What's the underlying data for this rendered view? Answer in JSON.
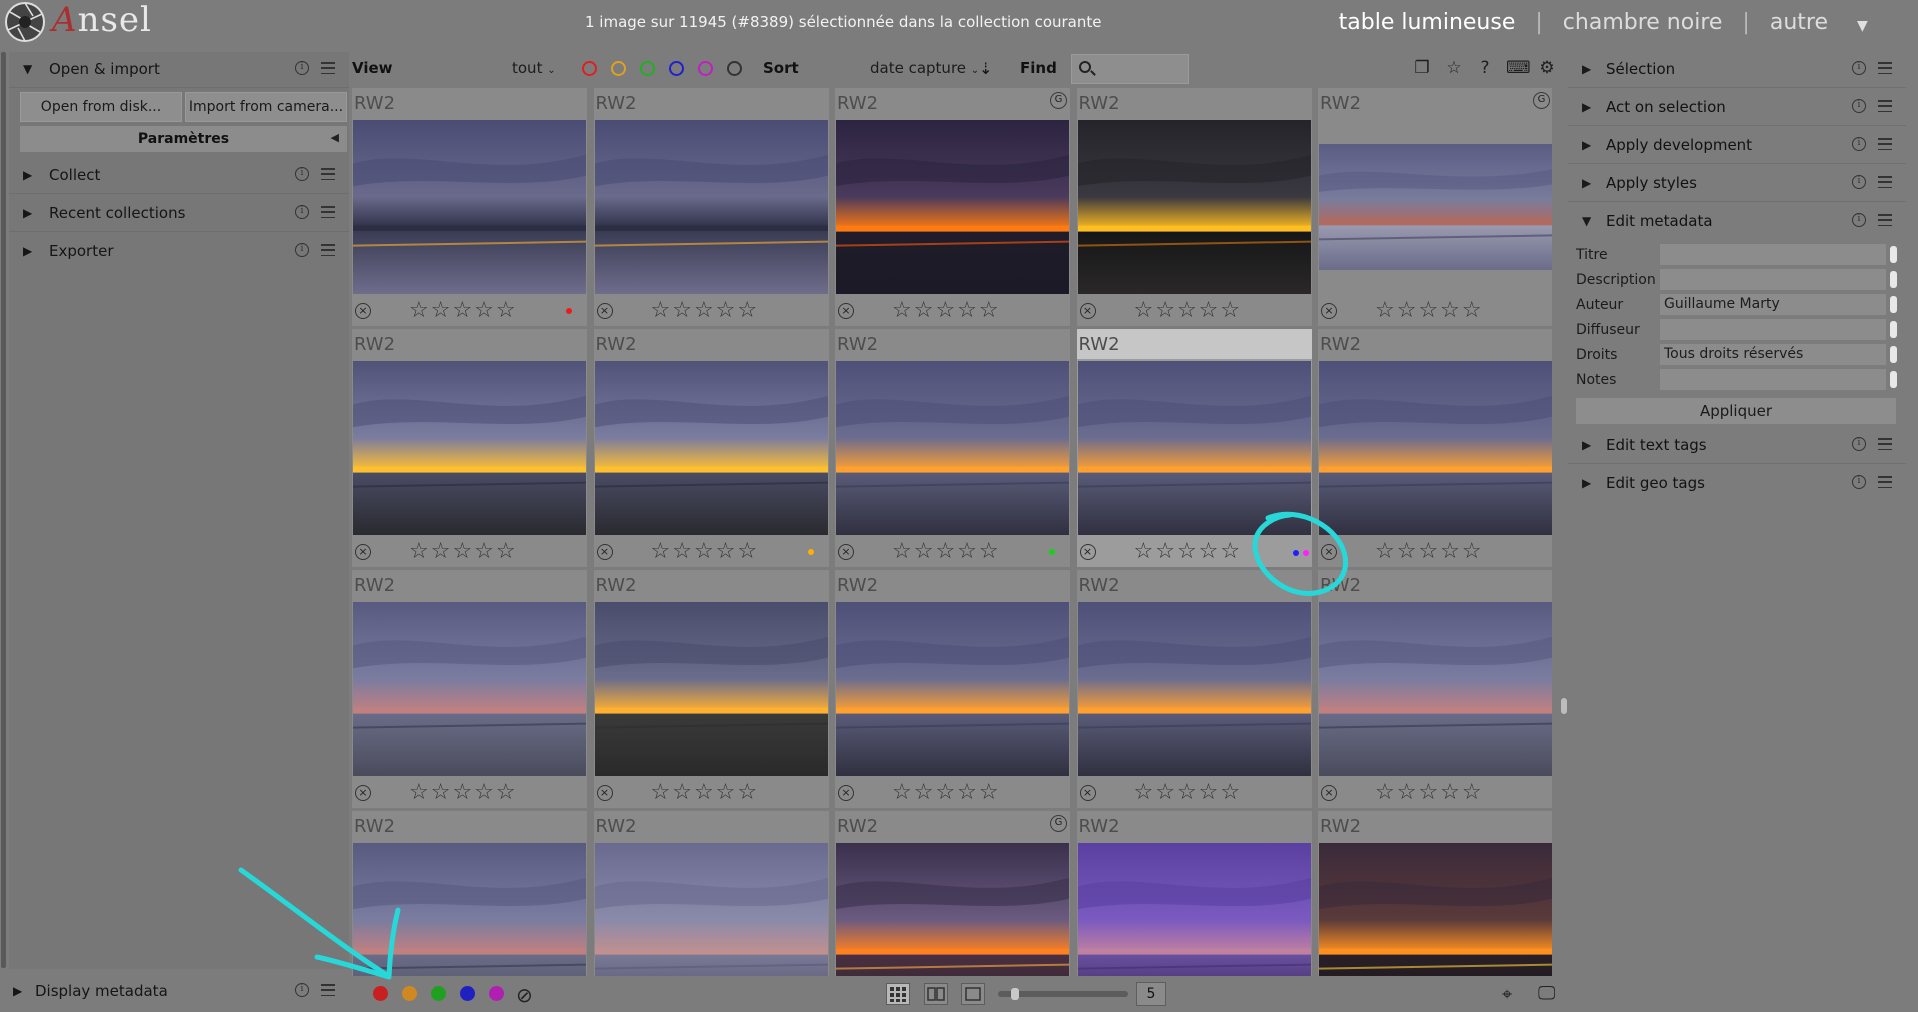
{
  "app": {
    "name": "Ansel",
    "status": "1 image sur 11945 (#8389) sélectionnée dans la collection courante",
    "views": [
      "table lumineuse",
      "chambre noire",
      "autre"
    ],
    "view_separator": "|",
    "active_view": "table lumineuse",
    "menu_arrow": "▼"
  },
  "left_panel": {
    "modules": [
      {
        "label": "Open & import",
        "expanded": true
      },
      {
        "label": "Collect",
        "expanded": false
      },
      {
        "label": "Recent collections",
        "expanded": false
      },
      {
        "label": "Exporter",
        "expanded": false
      }
    ],
    "buttons": {
      "open_disk": "Open from disk...",
      "import_camera": "Import from camera...",
      "params": "Paramètres"
    },
    "bottom_module": "Display metadata"
  },
  "toolbar": {
    "view_label": "View",
    "rating_filter": "tout",
    "color_filters": [
      "#dd2020",
      "#e0a020",
      "#20b020",
      "#2020d0",
      "#c020c0",
      "#8a8a8a"
    ],
    "sort_label": "Sort",
    "sort_value": "date capture",
    "find_label": "Find",
    "search_placeholder": ""
  },
  "grid": {
    "rows": 4,
    "cols": 5,
    "selected": [
      1,
      3
    ],
    "thumbs": [
      {
        "ext": "RW2",
        "grouped": false,
        "labels": [
          "#ee1a1a"
        ],
        "style": "a"
      },
      {
        "ext": "RW2",
        "grouped": false,
        "labels": [],
        "style": "a"
      },
      {
        "ext": "RW2",
        "grouped": true,
        "labels": [],
        "style": "b"
      },
      {
        "ext": "RW2",
        "grouped": false,
        "labels": [],
        "style": "c"
      },
      {
        "ext": "RW2",
        "grouped": true,
        "labels": [],
        "style": "d"
      },
      {
        "ext": "RW2",
        "grouped": false,
        "labels": [],
        "style": "e"
      },
      {
        "ext": "RW2",
        "grouped": false,
        "labels": [
          "#ffb000"
        ],
        "style": "e"
      },
      {
        "ext": "RW2",
        "grouped": false,
        "labels": [
          "#18d018"
        ],
        "style": "f"
      },
      {
        "ext": "RW2",
        "grouped": false,
        "labels": [
          "#2020ff",
          "#ff20ff"
        ],
        "style": "f"
      },
      {
        "ext": "RW2",
        "grouped": false,
        "labels": [],
        "style": "f"
      },
      {
        "ext": "RW2",
        "grouped": false,
        "labels": [],
        "style": "g"
      },
      {
        "ext": "RW2",
        "grouped": false,
        "labels": [],
        "style": "h"
      },
      {
        "ext": "RW2",
        "grouped": false,
        "labels": [],
        "style": "f"
      },
      {
        "ext": "RW2",
        "grouped": false,
        "labels": [],
        "style": "f"
      },
      {
        "ext": "RW2",
        "grouped": false,
        "labels": [],
        "style": "g"
      },
      {
        "ext": "RW2",
        "grouped": false,
        "labels": [],
        "style": "g"
      },
      {
        "ext": "RW2",
        "grouped": false,
        "labels": [],
        "style": "i"
      },
      {
        "ext": "RW2",
        "grouped": true,
        "labels": [],
        "style": "j"
      },
      {
        "ext": "RW2",
        "grouped": false,
        "labels": [],
        "style": "k"
      },
      {
        "ext": "RW2",
        "grouped": false,
        "labels": [],
        "style": "l"
      }
    ],
    "stars_text": "☆☆☆☆☆",
    "reject_symbol": "×",
    "group_symbol": "G"
  },
  "right_panel": {
    "modules_top": [
      "Sélection",
      "Act on selection",
      "Apply development",
      "Apply styles"
    ],
    "edit_metadata": {
      "label": "Edit metadata",
      "fields": [
        {
          "key": "Titre",
          "value": ""
        },
        {
          "key": "Description",
          "value": ""
        },
        {
          "key": "Auteur",
          "value": "Guillaume Marty"
        },
        {
          "key": "Diffuseur",
          "value": ""
        },
        {
          "key": "Droits",
          "value": "Tous droits réservés"
        },
        {
          "key": "Notes",
          "value": ""
        }
      ],
      "apply": "Appliquer"
    },
    "modules_bottom": [
      "Edit text tags",
      "Edit geo tags"
    ]
  },
  "bottom_bar": {
    "color_labels": [
      "#c82020",
      "#d08820",
      "#20a020",
      "#2020c0",
      "#b020b0"
    ],
    "clear_symbol": "⊘",
    "zoom_value": "5",
    "zoom_level": 0.1
  },
  "annotation_color": "#28d8d8"
}
